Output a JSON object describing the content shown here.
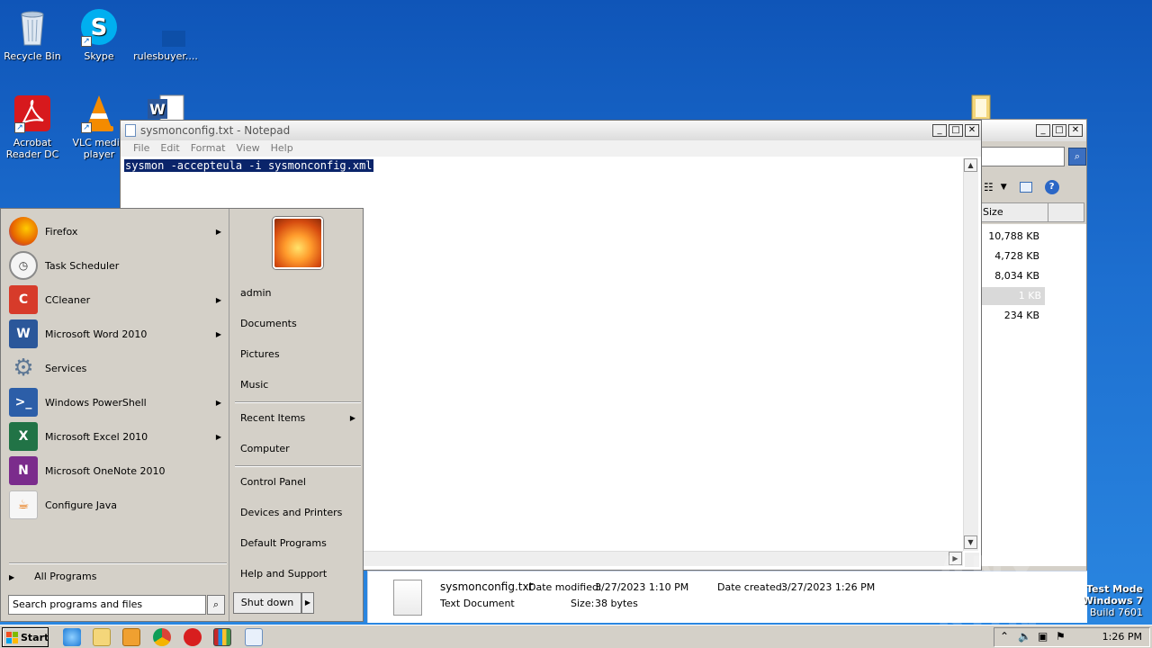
{
  "desktop": {
    "icons": [
      {
        "label": "Recycle Bin"
      },
      {
        "label": "Skype"
      },
      {
        "label": "rulesbuyer...."
      },
      {
        "label": "Acrobat Reader DC"
      },
      {
        "label": "VLC media player"
      }
    ]
  },
  "notepad": {
    "title": "sysmonconfig.txt - Notepad",
    "menu": [
      "File",
      "Edit",
      "Format",
      "View",
      "Help"
    ],
    "content": "sysmon -accepteula -i sysmonconfig.xml"
  },
  "explorer": {
    "column_header": "Size",
    "sizes": [
      "10,788 KB",
      "4,728 KB",
      "8,034 KB",
      "1 KB",
      "234 KB"
    ]
  },
  "details": {
    "filename": "sysmonconfig.txt",
    "filetype": "Text Document",
    "date_modified_label": "Date modified:",
    "date_modified": "3/27/2023 1:10 PM",
    "date_created_label": "Date created:",
    "date_created": "3/27/2023 1:26 PM",
    "size_label": "Size:",
    "size": "38 bytes"
  },
  "start_menu": {
    "programs": [
      {
        "label": "Firefox",
        "submenu": true,
        "color": "#e66000"
      },
      {
        "label": "Task Scheduler",
        "submenu": false,
        "color": "#c9c9c9"
      },
      {
        "label": "CCleaner",
        "submenu": true,
        "color": "#d73b2a"
      },
      {
        "label": "Microsoft Word 2010",
        "submenu": true,
        "color": "#2b579a"
      },
      {
        "label": "Services",
        "submenu": false,
        "color": "#7a8fa8"
      },
      {
        "label": "Windows PowerShell",
        "submenu": true,
        "color": "#2c5ea8"
      },
      {
        "label": "Microsoft Excel 2010",
        "submenu": true,
        "color": "#217346"
      },
      {
        "label": "Microsoft OneNote 2010",
        "submenu": false,
        "color": "#7b2c8c"
      },
      {
        "label": "Configure Java",
        "submenu": false,
        "color": "#e76f00"
      }
    ],
    "all_programs": "All Programs",
    "search_placeholder": "Search programs and files",
    "right_links": [
      "admin",
      "Documents",
      "Pictures",
      "Music",
      "Recent Items",
      "Computer",
      "Control Panel",
      "Devices and Printers",
      "Default Programs",
      "Help and Support"
    ],
    "shutdown": "Shut down"
  },
  "taskbar": {
    "start": "Start",
    "clock": "1:26 PM"
  },
  "watermark": {
    "line1": "Test Mode",
    "line2": "Windows 7",
    "line3": "Build 7601",
    "brand": "ANY RUN"
  }
}
